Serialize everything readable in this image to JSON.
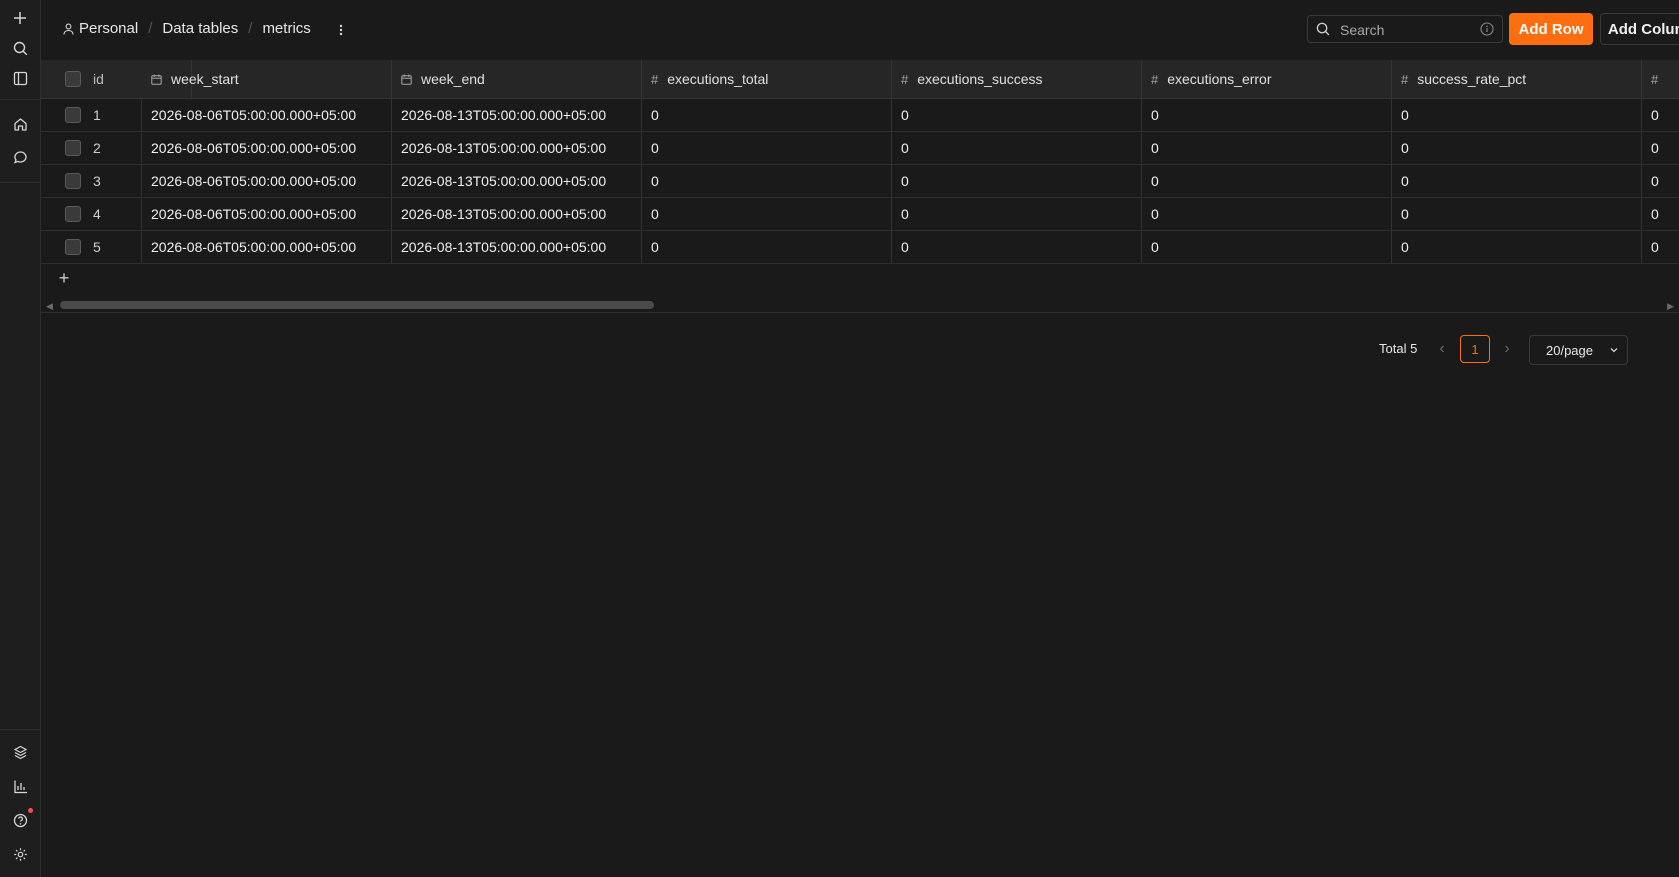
{
  "breadcrumb": {
    "items": [
      "Personal",
      "Data tables",
      "metrics"
    ],
    "separator": "/"
  },
  "search": {
    "placeholder": "Search"
  },
  "actions": {
    "add_row": "Add Row",
    "add_column": "Add Column"
  },
  "table": {
    "columns": [
      {
        "name": "id",
        "type": "none"
      },
      {
        "name": "week_start",
        "type": "date"
      },
      {
        "name": "week_end",
        "type": "date"
      },
      {
        "name": "executions_total",
        "type": "number"
      },
      {
        "name": "executions_success",
        "type": "number"
      },
      {
        "name": "executions_error",
        "type": "number"
      },
      {
        "name": "success_rate_pct",
        "type": "number"
      },
      {
        "name": "",
        "type": "number"
      }
    ],
    "rows": [
      [
        "1",
        "2026-08-06T05:00:00.000+05:00",
        "2026-08-13T05:00:00.000+05:00",
        "0",
        "0",
        "0",
        "0",
        "0"
      ],
      [
        "2",
        "2026-08-06T05:00:00.000+05:00",
        "2026-08-13T05:00:00.000+05:00",
        "0",
        "0",
        "0",
        "0",
        "0"
      ],
      [
        "3",
        "2026-08-06T05:00:00.000+05:00",
        "2026-08-13T05:00:00.000+05:00",
        "0",
        "0",
        "0",
        "0",
        "0"
      ],
      [
        "4",
        "2026-08-06T05:00:00.000+05:00",
        "2026-08-13T05:00:00.000+05:00",
        "0",
        "0",
        "0",
        "0",
        "0"
      ],
      [
        "5",
        "2026-08-06T05:00:00.000+05:00",
        "2026-08-13T05:00:00.000+05:00",
        "0",
        "0",
        "0",
        "0",
        "0"
      ]
    ],
    "add_row_glyph": "+"
  },
  "pagination": {
    "total_label": "Total 5",
    "current_page": "1",
    "page_size": "20/page"
  },
  "sidebar": {
    "top_icons": [
      "plus-icon",
      "search-icon",
      "panel-toggle-icon",
      "home-icon",
      "chat-icon"
    ],
    "bottom_icons": [
      "templates-icon",
      "insights-icon",
      "help-icon",
      "settings-icon"
    ]
  },
  "colors": {
    "accent": "#ff6d11",
    "background": "#1a1a1a",
    "notification_dot": "#ff4d4f"
  }
}
